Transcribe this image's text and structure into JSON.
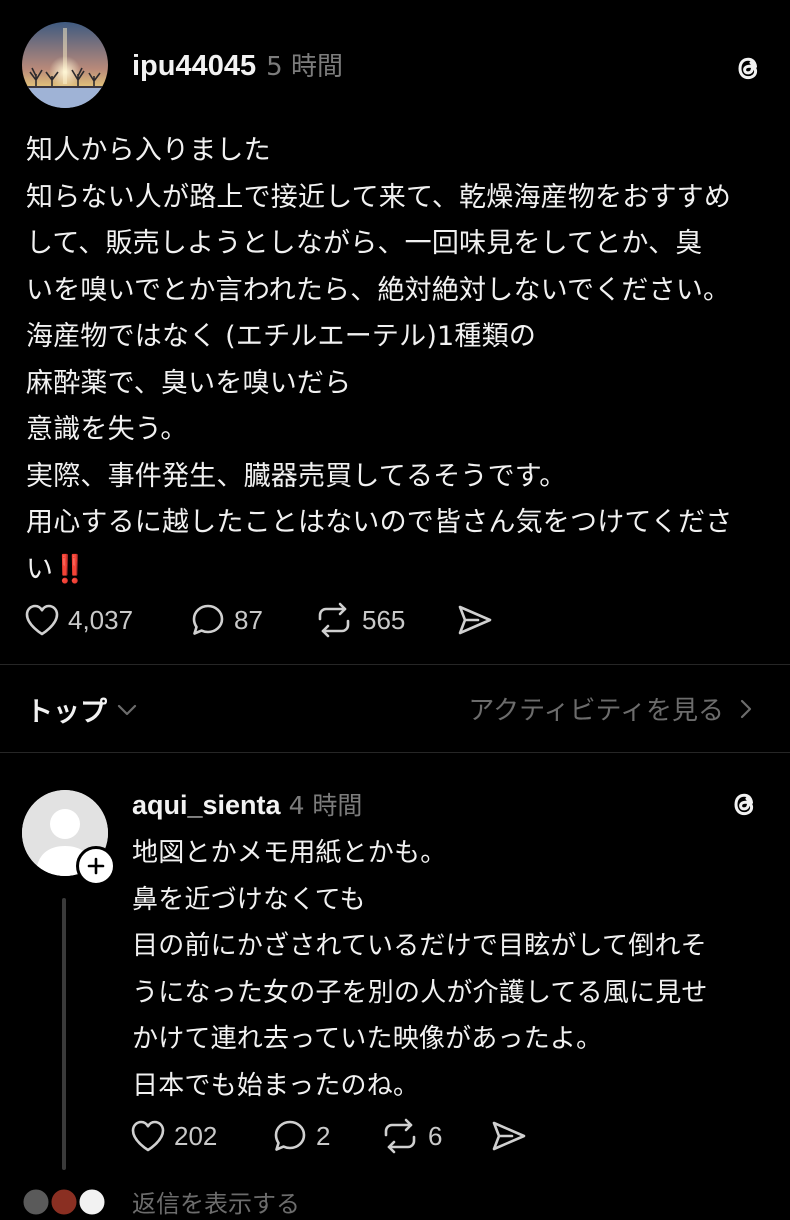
{
  "post": {
    "username": "ipu44045",
    "timestamp": "5 時間",
    "lines": [
      "知人から入りました",
      "知らない人が路上で接近して来て、乾燥海産物をおすすめ",
      "して、販売しようとしながら、一回味見をしてとか、臭",
      "いを嗅いでとか言われたら、絶対絶対しないでください。",
      "海産物ではなく (エチルエーテル)1種類の",
      "麻酔薬で、臭いを嗅いだら",
      "意識を失う。",
      "実際、事件発生、臓器売買してるそうです。",
      "用心するに越したことはないので皆さん気をつけてくださ",
      "い"
    ],
    "alarm_emoji": "‼️",
    "likes": "4,037",
    "comments": "87",
    "reposts": "565"
  },
  "sort": {
    "label": "トップ",
    "activity_link": "アクティビティを見る"
  },
  "reply": {
    "username": "aqui_sienta",
    "timestamp": "4 時間",
    "lines": [
      "地図とかメモ用紙とかも。",
      "鼻を近づけなくても",
      "目の前にかざされているだけで目眩がして倒れそ",
      "うになった女の子を別の人が介護してる風に見せ",
      "かけて連れ去っていた映像があったよ。",
      "日本でも始まったのね。"
    ],
    "likes": "202",
    "comments": "2",
    "reposts": "6",
    "more_replies": "返信を表示する"
  },
  "colors": {
    "background": "#000000",
    "text": "#f1f1f1",
    "muted": "#7c7c7c",
    "alarm": "#e4242c",
    "divider": "#262626"
  },
  "icons": {
    "app": "threads-icon",
    "like": "heart-icon",
    "comment": "comment-bubble-icon",
    "repost": "repost-icon",
    "share": "send-icon"
  }
}
